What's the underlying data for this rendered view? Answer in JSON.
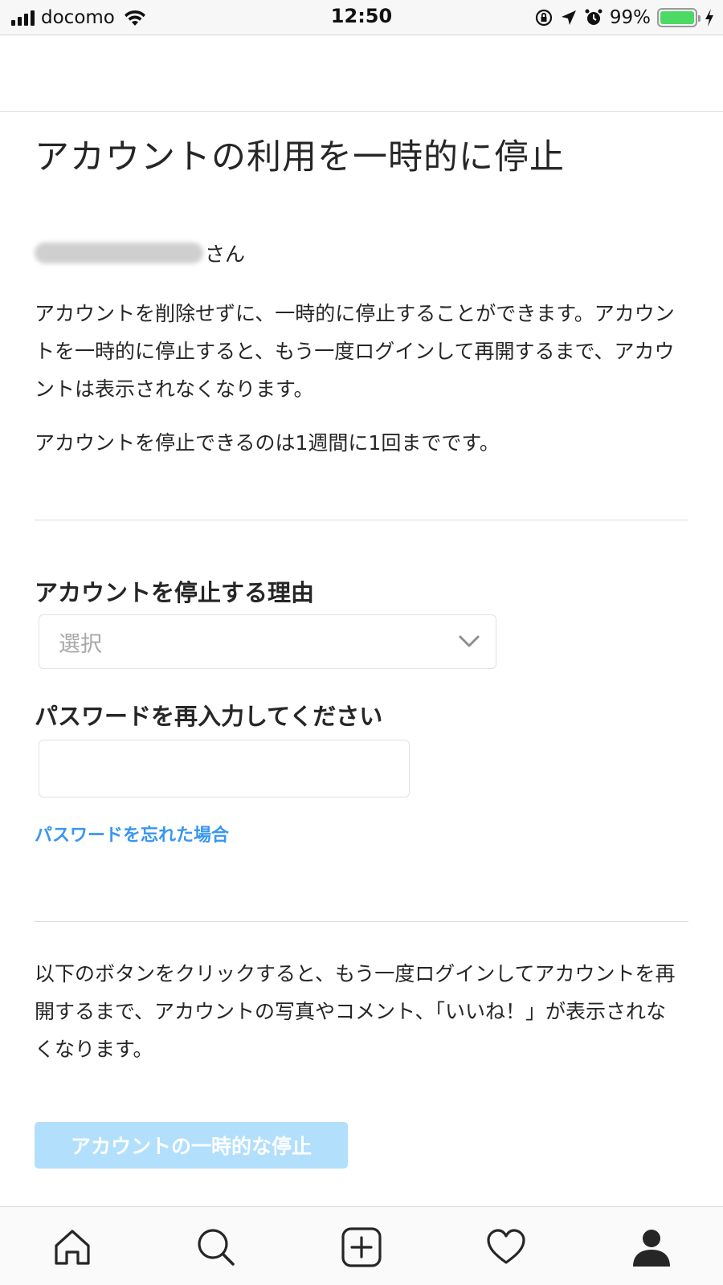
{
  "status_bar": {
    "carrier": "docomo",
    "time": "12:50",
    "battery_percent": "99%",
    "battery_level": 0.99,
    "icons": [
      "signal-icon",
      "wifi-icon",
      "rotation-lock-icon",
      "location-icon",
      "alarm-icon",
      "battery-icon",
      "charging-icon"
    ]
  },
  "page": {
    "title": "アカウントの利用を一時的に停止",
    "username_suffix": "さん",
    "description_1": "アカウントを削除せずに、一時的に停止することができます。アカウントを一時的に停止すると、もう一度ログインして再開するまで、アカウントは表示されなくなります。",
    "description_2": "アカウントを停止できるのは1週間に1回までです。"
  },
  "form": {
    "reason_label": "アカウントを停止する理由",
    "reason_select_value": "選択",
    "password_label": "パスワードを再入力してください",
    "password_value": "",
    "forgot_password_link": "パスワードを忘れた場合"
  },
  "footer": {
    "notice": "以下のボタンをクリックすると、もう一度ログインしてアカウントを再開するまで、アカウントの写真やコメント、「いいね！」が表示されなくなります。",
    "button_label": "アカウントの一時的な停止"
  },
  "tab_bar": {
    "tabs": [
      "home-icon",
      "search-icon",
      "add-post-icon",
      "heart-icon",
      "profile-icon"
    ]
  },
  "colors": {
    "link": "#3897f0",
    "button_disabled": "#b2dffc",
    "battery": "#4cd964"
  }
}
